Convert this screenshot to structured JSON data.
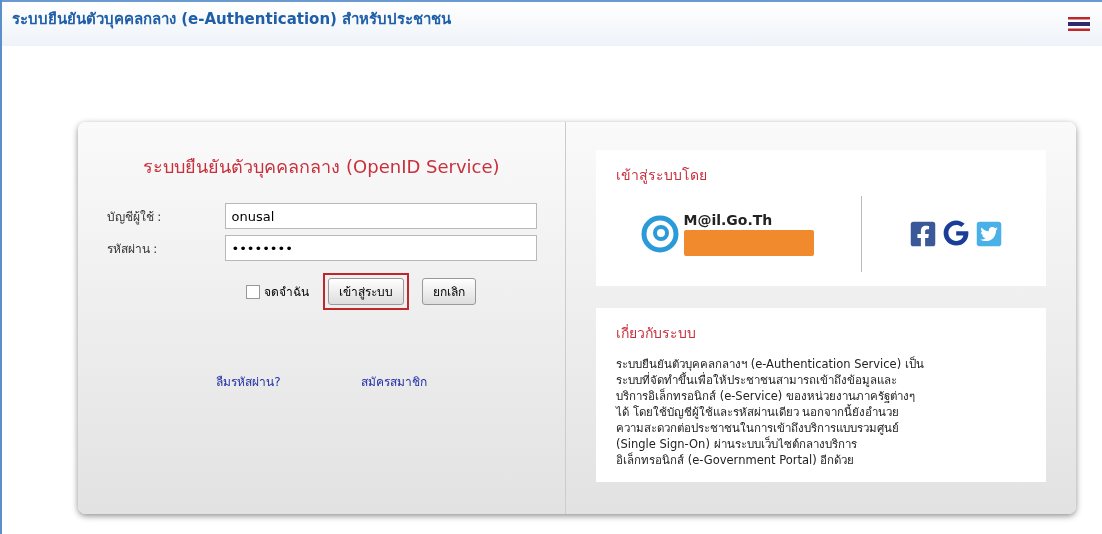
{
  "header": {
    "title": "ระบบยืนยันตัวบุคคลกลาง (e-Authentication) สำหรับประชาชน"
  },
  "login": {
    "title": "ระบบยืนยันตัวบุคคลกลาง (OpenID Service)",
    "fields": [
      {
        "label": "บัญชีผู้ใช้ :",
        "value": "onusal"
      },
      {
        "label": "รหัสผ่าน :",
        "value": "••••••••"
      }
    ],
    "remember": {
      "label": "จดจำฉัน",
      "checked": false
    },
    "buttons": [
      {
        "label": "เข้าสู่ระบบ",
        "highlighted": true
      },
      {
        "label": "ยกเลิก",
        "highlighted": false
      }
    ],
    "links": [
      "ลืมรหัสผ่าน?",
      "สมัครสมาชิก"
    ]
  },
  "signin_with": {
    "title": "เข้าสู่ระบบโดย",
    "mail_logo": "M@il.Go.Th"
  },
  "about": {
    "title": "เกี่ยวกับระบบ",
    "lines": [
      "ระบบยืนยันตัวบุคคลกลางฯ (e-Authentication Service) เป็น",
      "ระบบที่จัดทำขึ้นเพื่อให้ประชาชนสามารถเข้าถึงข้อมูลและ",
      "บริการอิเล็กทรอนิกส์ (e-Service) ของหน่วยงานภาครัฐต่างๆ",
      "ได้ โดยใช้บัญชีผู้ใช้และรหัสผ่านเดียว นอกจากนี้ยังอำนวย",
      "ความสะดวกต่อประชาชนในการเข้าถึงบริการแบบรวมศูนย์",
      "(Single Sign-On) ผ่านระบบเว็บไซต์กลางบริการ",
      "อิเล็กทรอนิกส์ (e-Government Portal) อีกด้วย"
    ]
  }
}
